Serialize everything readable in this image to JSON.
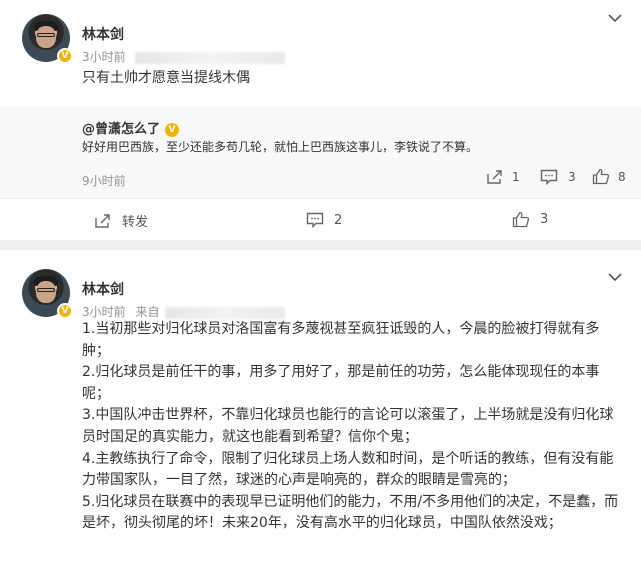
{
  "post1": {
    "username": "林本剑",
    "time": "3小时前",
    "text": "只有土帅才愿意当提线木偶",
    "reference": {
      "username": "@曾潇怎么了",
      "text": "好好用巴西族，至少还能多苟几轮，就怕上巴西族这事儿，李铁说了不算。",
      "time": "9小时前",
      "repost_count": "1",
      "comment_count": "3",
      "like_count": "8"
    },
    "actions": {
      "repost_label": "转发",
      "comment_count": "2",
      "like_count": "3"
    }
  },
  "post2": {
    "username": "林本剑",
    "time": "3小时前",
    "source_prefix": "来自",
    "lines": [
      "1.当初那些对归化球员对洛国富有多蔑视甚至疯狂诋毁的人，今晨的脸被打得就有多",
      "肿；",
      "2.归化球员是前任干的事，用多了用好了，那是前任的功劳，怎么能体现现任的本事",
      "呢；",
      "3.中国队冲击世界杯，不靠归化球员也能行的言论可以滚蛋了，上半场就是没有归化球",
      "员时国足的真实能力，就这也能看到希望？信你个鬼；",
      "4.主教练执行了命令，限制了归化球员上场人数和时间，是个听话的教练，但有没有能",
      "力带国家队，一目了然，球迷的心声是响亮的，群众的眼睛是雪亮的；",
      "5.归化球员在联赛中的表现早已证明他们的能力，不用/不多用他们的决定，不是蠢，而",
      "是坏，彻头彻尾的坏！未来20年，没有高水平的归化球员，中国队依然没戏；"
    ]
  },
  "icons": {
    "verified": "V"
  }
}
